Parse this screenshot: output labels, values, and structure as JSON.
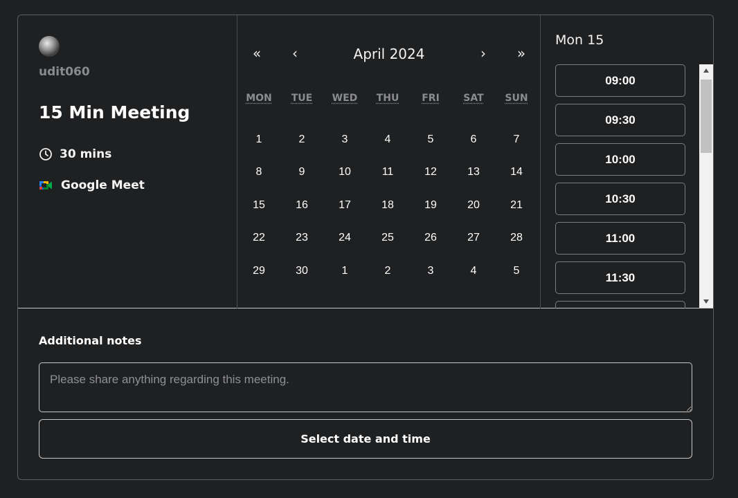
{
  "host": {
    "username": "udit060"
  },
  "event": {
    "title": "15 Min Meeting",
    "duration": "30 mins",
    "location": "Google Meet"
  },
  "calendar": {
    "month_label": "April 2024",
    "nav": {
      "prev_year": "«",
      "prev_month": "‹",
      "next_month": "›",
      "next_year": "»"
    },
    "weekdays": [
      "MON",
      "TUE",
      "WED",
      "THU",
      "FRI",
      "SAT",
      "SUN"
    ],
    "days": [
      "1",
      "2",
      "3",
      "4",
      "5",
      "6",
      "7",
      "8",
      "9",
      "10",
      "11",
      "12",
      "13",
      "14",
      "15",
      "16",
      "17",
      "18",
      "19",
      "20",
      "21",
      "22",
      "23",
      "24",
      "25",
      "26",
      "27",
      "28",
      "29",
      "30",
      "1",
      "2",
      "3",
      "4",
      "5"
    ]
  },
  "slots": {
    "date_label": "Mon 15",
    "times": [
      "09:00",
      "09:30",
      "10:00",
      "10:30",
      "11:00",
      "11:30",
      ""
    ]
  },
  "notes": {
    "label": "Additional notes",
    "placeholder": "Please share anything regarding this meeting."
  },
  "submit": {
    "label": "Select date and time"
  }
}
